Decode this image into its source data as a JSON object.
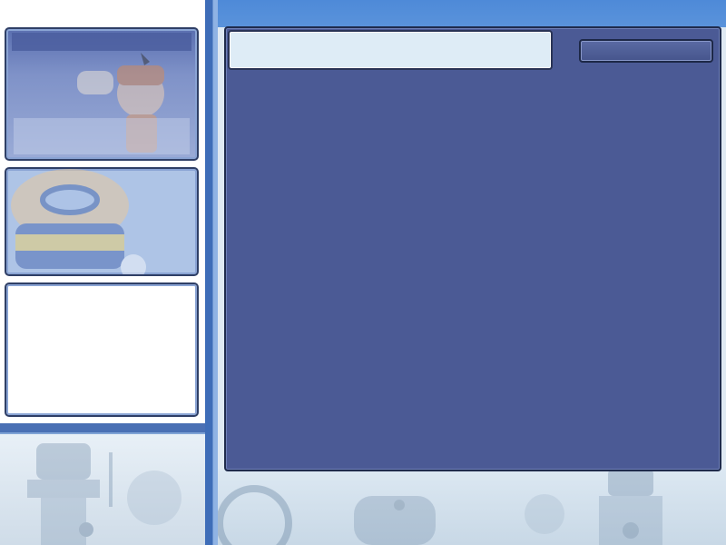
{
  "main": {
    "text_box_value": "",
    "action_button_label": ""
  },
  "colors": {
    "main_panel": "#4b5a95",
    "accent_blue": "#4e8ad8",
    "text_box": "#deecf6",
    "divider": "#3e6db8"
  },
  "icons": [
    "character-portrait-icon",
    "character-portrait-icon",
    "lighthouse-icon",
    "robot-icon"
  ]
}
